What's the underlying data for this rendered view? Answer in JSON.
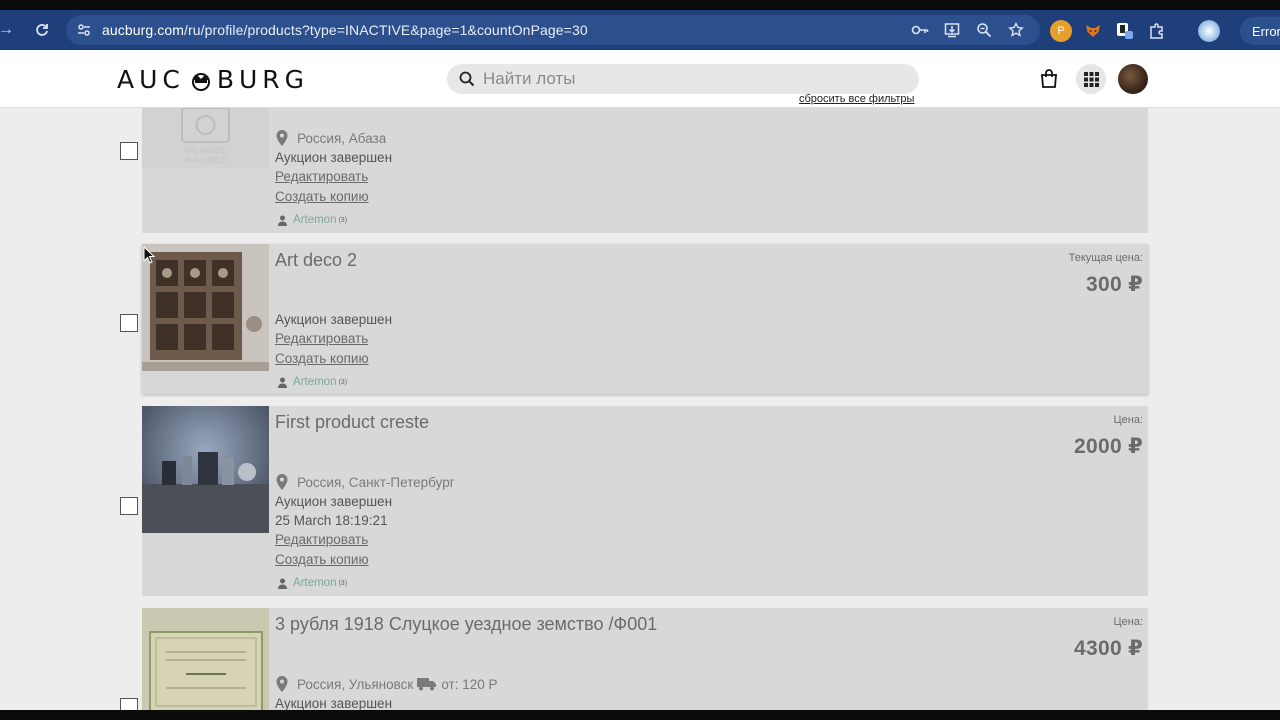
{
  "browser": {
    "url_domain": "aucburg.com",
    "url_path": "/ru/profile/products?type=INACTIVE&page=1&countOnPage=30",
    "error_label": "Error"
  },
  "header": {
    "logo_text_left": "AUC",
    "logo_text_right": "BURG",
    "search_placeholder": "Найти лоты",
    "reset_filters": "сбросить все фильтры"
  },
  "products": [
    {
      "title": "",
      "location": "Россия, Абаза",
      "status": "Аукцион завершен",
      "edit": "Редактировать",
      "copy": "Создать копию",
      "seller": "Artemon",
      "seller_rating": "(3)",
      "no_image_text": "NO IMAGE AVAILABLE"
    },
    {
      "title": "Art deco 2",
      "price_label": "Текущая цена:",
      "price": "300 ₽",
      "status": "Аукцион завершен",
      "edit": "Редактировать",
      "copy": "Создать копию",
      "seller": "Artemon",
      "seller_rating": "(3)"
    },
    {
      "title": "First product creste",
      "price_label": "Цена:",
      "price": "2000 ₽",
      "location": "Россия, Санкт-Петербург",
      "status": "Аукцион завершен",
      "date": "25 March 18:19:21",
      "edit": "Редактировать",
      "copy": "Создать копию",
      "seller": "Artemon",
      "seller_rating": "(3)"
    },
    {
      "title": "3 рубля 1918 Слуцкое уездное земство /Ф001",
      "price_label": "Цена:",
      "price": "4300 ₽",
      "location": "Россия, Ульяновск",
      "delivery": "от: 120 Р",
      "status": "Аукцион завершен"
    }
  ],
  "colors": {
    "browser_bar": "#1f3f7a",
    "card_bg": "#d8d8d8",
    "seller_green": "#7aa89a"
  }
}
